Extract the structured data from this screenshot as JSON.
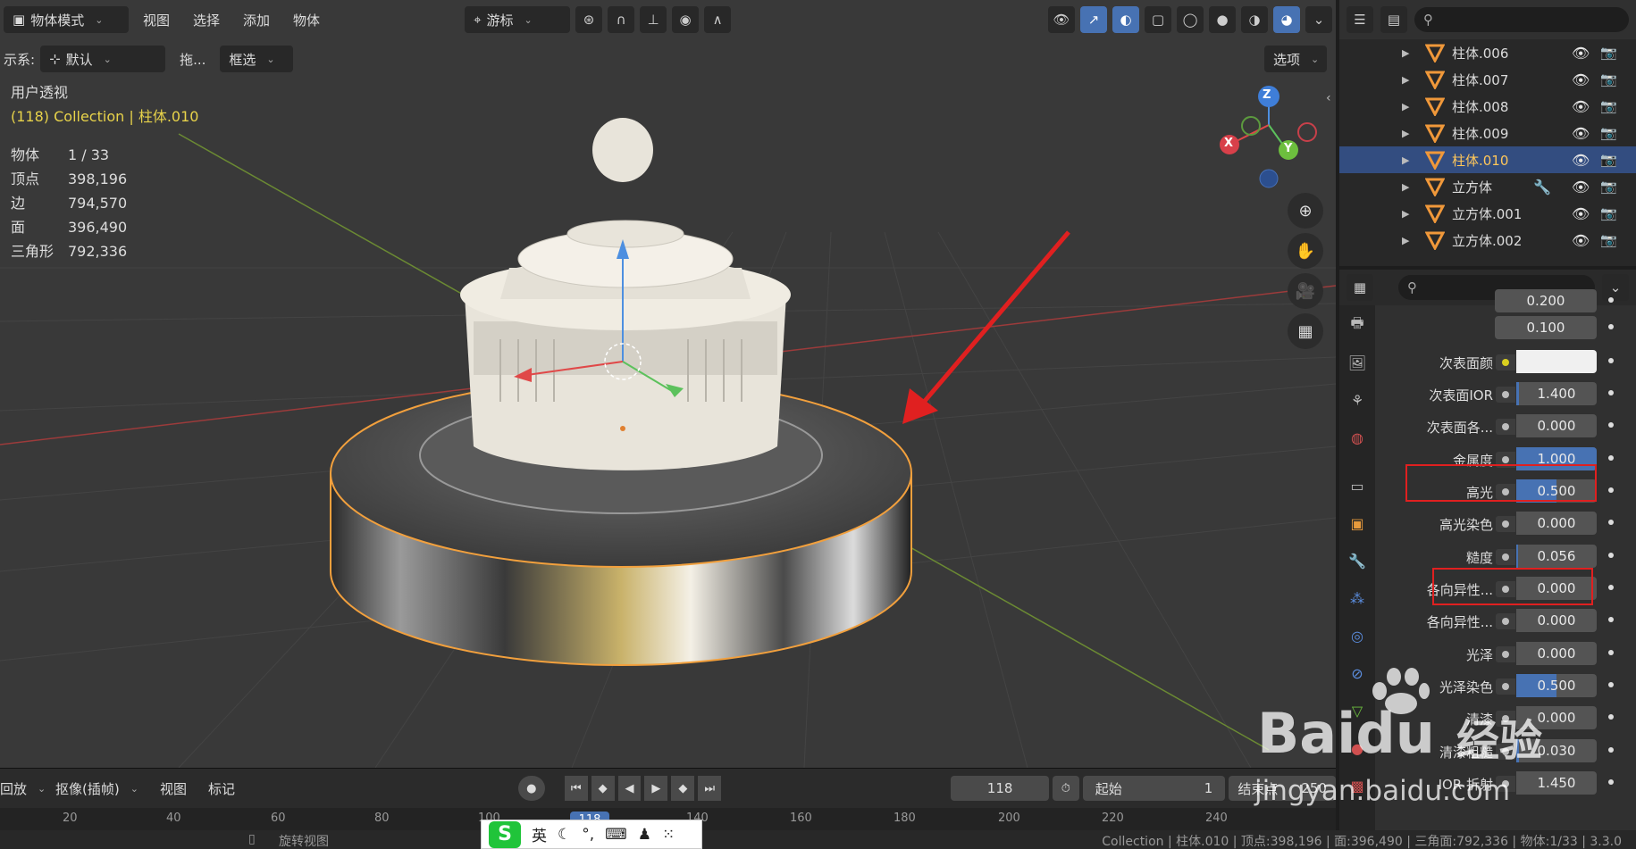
{
  "viewport_header": {
    "mode": "物体模式",
    "menus": [
      "视图",
      "选择",
      "添加",
      "物体"
    ],
    "transform_pivot": "游标"
  },
  "viewport_header2": {
    "orientation_prefix": "示系:",
    "orientation": "默认",
    "drag_label": "拖...",
    "select_mode": "框选",
    "options": "选项"
  },
  "viewport_overlay": {
    "view_name": "用户透视",
    "collection_info": "(118) Collection | 柱体.010",
    "stats": [
      {
        "label": "物体",
        "value": "1 / 33"
      },
      {
        "label": "顶点",
        "value": "398,196"
      },
      {
        "label": "边",
        "value": "794,570"
      },
      {
        "label": "面",
        "value": "396,490"
      },
      {
        "label": "三角形",
        "value": "792,336"
      }
    ],
    "gizmo": {
      "x": "X",
      "y": "Y",
      "z": "Z"
    }
  },
  "timeline": {
    "playback": "回放",
    "keying": "抠像(插帧)",
    "view": "视图",
    "marker": "标记",
    "current_frame": "118",
    "start_label": "起始",
    "start_value": "1",
    "end_label": "结束点",
    "end_value": "250",
    "ticks": [
      "20",
      "40",
      "60",
      "80",
      "100",
      "118",
      "140",
      "160",
      "180",
      "200",
      "220",
      "240"
    ]
  },
  "statusbar": {
    "left": "旋转视图",
    "right": "Collection | 柱体.010 | 顶点:398,196 | 面:396,490 | 三角面:792,336 | 物体:1/33 | 3.3.0"
  },
  "ime": {
    "logo": "S",
    "lang": "英"
  },
  "outliner": {
    "items": [
      {
        "name": "柱体.006",
        "selected": false,
        "modifier": false
      },
      {
        "name": "柱体.007",
        "selected": false,
        "modifier": false
      },
      {
        "name": "柱体.008",
        "selected": false,
        "modifier": false
      },
      {
        "name": "柱体.009",
        "selected": false,
        "modifier": false
      },
      {
        "name": "柱体.010",
        "selected": true,
        "modifier": false
      },
      {
        "name": "立方体",
        "selected": false,
        "modifier": true
      },
      {
        "name": "立方体.001",
        "selected": false,
        "modifier": false
      },
      {
        "name": "立方体.002",
        "selected": false,
        "modifier": false
      }
    ]
  },
  "properties": {
    "rows": [
      {
        "label": "",
        "value": "0.200",
        "fill": 0,
        "dot": false
      },
      {
        "label": "",
        "value": "0.100",
        "fill": 0,
        "dot": false
      },
      {
        "label": "次表面颜",
        "value": "",
        "fill": 0,
        "dot": "yellow",
        "white": true
      },
      {
        "label": "次表面IOR",
        "value": "1.400",
        "fill": 0.03,
        "dot": true
      },
      {
        "label": "次表面各...",
        "value": "0.000",
        "fill": 0,
        "dot": true
      },
      {
        "label": "金属度",
        "value": "1.000",
        "fill": 1.0,
        "dot": true
      },
      {
        "label": "高光",
        "value": "0.500",
        "fill": 0.5,
        "dot": true
      },
      {
        "label": "高光染色",
        "value": "0.000",
        "fill": 0,
        "dot": true
      },
      {
        "label": "糙度",
        "value": "0.056",
        "fill": 0.02,
        "dot": true
      },
      {
        "label": "各向异性...",
        "value": "0.000",
        "fill": 0,
        "dot": true
      },
      {
        "label": "各向异性...",
        "value": "0.000",
        "fill": 0,
        "dot": true
      },
      {
        "label": "光泽",
        "value": "0.000",
        "fill": 0,
        "dot": true
      },
      {
        "label": "光泽染色",
        "value": "0.500",
        "fill": 0.5,
        "dot": true
      },
      {
        "label": "清漆",
        "value": "0.000",
        "fill": 0,
        "dot": true
      },
      {
        "label": "清漆粗糙",
        "value": "0.030",
        "fill": 0.03,
        "dot": true
      },
      {
        "label": "IOR 折射",
        "value": "1.450",
        "fill": 0,
        "dot": true
      }
    ]
  },
  "watermark": {
    "brand": "Bai",
    "brand2": "du",
    "cn": "经验",
    "url": "jingyan.baidu.com"
  },
  "colors": {
    "accent": "#4772b3",
    "selected_text": "#ffc75a",
    "highlight_box": "#e02020",
    "arrow": "#e02020",
    "outline": "#f2a03d"
  }
}
